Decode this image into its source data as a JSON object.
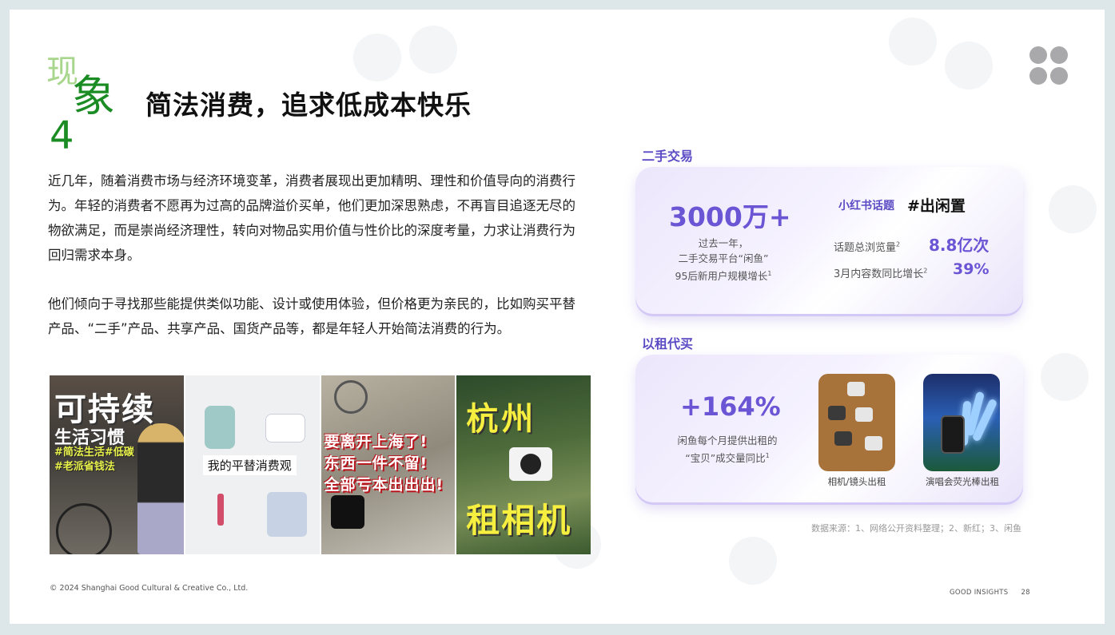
{
  "badge": {
    "char1": "现",
    "char2": "象",
    "char3": "4"
  },
  "title": "简法消费，追求低成本快乐",
  "paragraphs": [
    "近几年，随着消费市场与经济环境变革，消费者展现出更加精明、理性和价值导向的消费行为。年轻的消费者不愿再为过高的品牌溢价买单，他们更加深思熟虑，不再盲目追逐无尽的物欲满足，而是崇尚经济理性，转向对物品实用价值与性价比的深度考量，力求让消费行为回归需求本身。",
    "他们倾向于寻找那些能提供类似功能、设计或使用体验，但价格更为亲民的，比如购买平替产品、“二手”产品、共享产品、国货产品等，都是年轻人开始简法消费的行为。"
  ],
  "photos": {
    "p1": {
      "title": "可持续",
      "subtitle": "生活习惯",
      "tags": "#简法生活#低碳\n#老派省钱法"
    },
    "p2": {
      "caption": "我的平替消费观"
    },
    "p3": {
      "text": "要离开上海了!\n东西一件不留!\n全部亏本出出出!"
    },
    "p4": {
      "top": "杭州",
      "bottom": "租相机"
    }
  },
  "section1": {
    "title": "二手交易",
    "big_value": "3000万+",
    "caption_lines": [
      "过去一年，",
      "二手交易平台“闲鱼”",
      "95后新用户规模增长"
    ],
    "caption_sup": "1",
    "topic_label": "小红书话题",
    "topic_tag": "#出闲置",
    "stats": [
      {
        "label": "话题总浏览量",
        "sup": "2",
        "value": "8.8亿次"
      },
      {
        "label": "3月内容数同比增长",
        "sup": "2",
        "value": "39%"
      }
    ]
  },
  "section2": {
    "title": "以租代买",
    "big_value": "+164%",
    "caption_lines": [
      "闲鱼每个月提供出租的",
      "“宝贝”成交量同比"
    ],
    "caption_sup": "1",
    "thumb1_caption": "相机/镜头出租",
    "thumb2_caption": "演唱会荧光棒出租"
  },
  "source": "数据来源：1、网络公开资料整理；2、新红；3、闲鱼",
  "copyright": "© 2024 Shanghai Good Cultural & Creative Co., Ltd.",
  "footer": {
    "brand": "GOOD INSIGHTS",
    "page": "28"
  },
  "colors": {
    "accent_green": "#1a8c23",
    "light_green": "#a7d68c",
    "accent_purple": "#6a55d4"
  }
}
